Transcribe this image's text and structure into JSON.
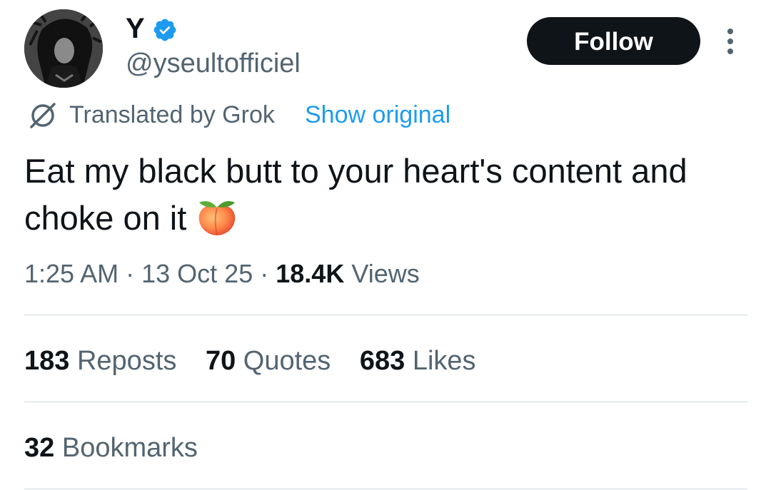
{
  "author": {
    "display_name": "Y",
    "handle": "@yseultofficiel",
    "verified": true,
    "verified_color": "#1d9bf0"
  },
  "actions": {
    "follow_label": "Follow"
  },
  "translation": {
    "label": "Translated by Grok",
    "show_original_label": "Show original",
    "icon": "grok-icon"
  },
  "tweet": {
    "text": "Eat my black butt to your heart's content and choke on it",
    "emoji": "peach-emoji"
  },
  "meta": {
    "time": "1:25 AM",
    "separator": "·",
    "date": "13 Oct 25",
    "views_count": "18.4K",
    "views_label": "Views"
  },
  "stats": {
    "reposts": {
      "count": "183",
      "label": "Reposts"
    },
    "quotes": {
      "count": "70",
      "label": "Quotes"
    },
    "likes": {
      "count": "683",
      "label": "Likes"
    },
    "bookmarks": {
      "count": "32",
      "label": "Bookmarks"
    }
  },
  "colors": {
    "text_primary": "#0f1419",
    "text_secondary": "#536471",
    "link": "#1d9bf0",
    "divider": "#cfd9de",
    "button_bg": "#0f1419"
  }
}
